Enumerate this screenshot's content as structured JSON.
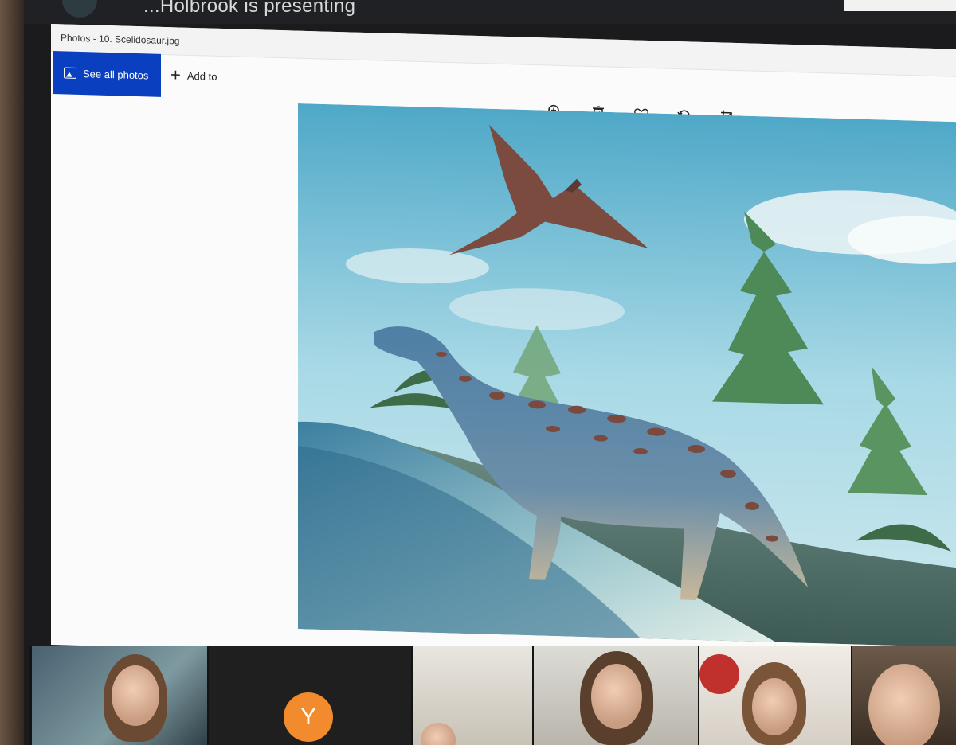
{
  "meeting": {
    "presenter_text": "...Holbrook is presenting"
  },
  "window": {
    "title": "Photos - 10. Scelidosaur.jpg"
  },
  "toolbar": {
    "see_all_label": "See all photos",
    "add_to_label": "Add to",
    "icons": [
      "zoom-in-icon",
      "delete-icon",
      "favorite-icon",
      "rotate-icon",
      "crop-icon"
    ]
  },
  "photo": {
    "subject": "Scelidosaur illustration"
  },
  "participants": {
    "avatar_initial": "Y",
    "avatar_color": "#f28b2e"
  },
  "colors": {
    "accent": "#0a3fbf",
    "window_bg": "#fbfbfb"
  }
}
